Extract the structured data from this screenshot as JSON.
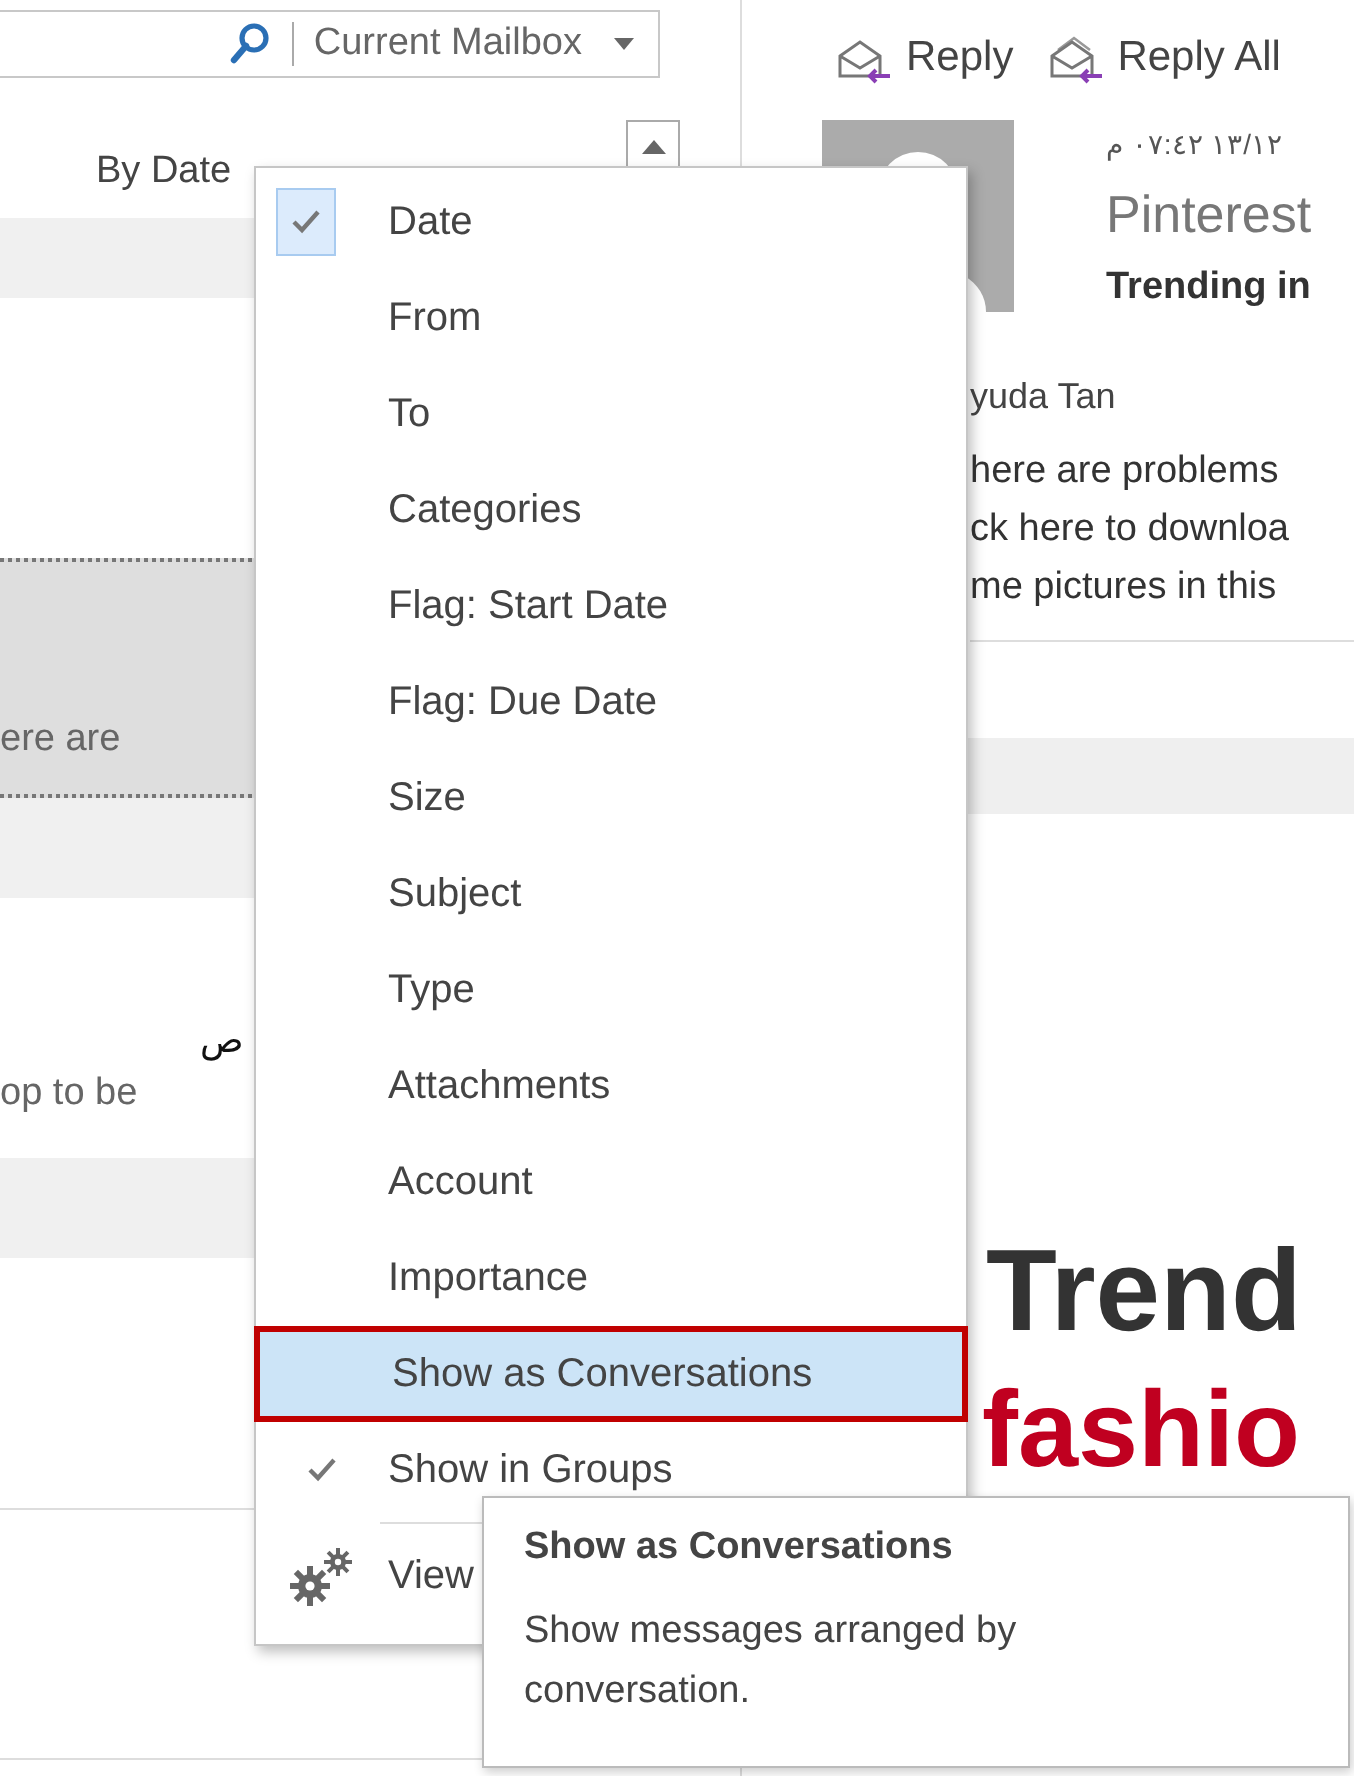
{
  "search": {
    "scope": "Current Mailbox"
  },
  "message_list": {
    "sort_label": "By Date",
    "rows": [
      {
        "kind": "selected",
        "snippet": "ere are"
      },
      {
        "kind": "plain",
        "sender": "ص",
        "snippet": "op to be"
      }
    ]
  },
  "reading_pane": {
    "actions": [
      "Reply",
      "Reply All"
    ],
    "date": "١٣/١٢ ٠٧:٤٢ م",
    "sender": "Pinterest",
    "subject": "Trending in",
    "to": "yuda Tan",
    "notice": [
      "here are problems",
      "ck here to downloa",
      "me pictures in this"
    ],
    "headline": "Trend",
    "headline_accent": "fashio"
  },
  "sort_menu": {
    "items": [
      {
        "kind": "sort",
        "label": "Date",
        "checked": true,
        "selected": false
      },
      {
        "kind": "sort",
        "label": "From",
        "checked": false,
        "selected": false
      },
      {
        "kind": "sort",
        "label": "To",
        "checked": false,
        "selected": false
      },
      {
        "kind": "sort",
        "label": "Categories",
        "checked": false,
        "selected": false
      },
      {
        "kind": "sort",
        "label": "Flag: Start Date",
        "checked": false,
        "selected": false
      },
      {
        "kind": "sort",
        "label": "Flag: Due Date",
        "checked": false,
        "selected": false
      },
      {
        "kind": "sort",
        "label": "Size",
        "checked": false,
        "selected": false
      },
      {
        "kind": "sort",
        "label": "Subject",
        "checked": false,
        "selected": false
      },
      {
        "kind": "sort",
        "label": "Type",
        "checked": false,
        "selected": false
      },
      {
        "kind": "sort",
        "label": "Attachments",
        "checked": false,
        "selected": false
      },
      {
        "kind": "sort",
        "label": "Account",
        "checked": false,
        "selected": false
      },
      {
        "kind": "sort",
        "label": "Importance",
        "checked": false,
        "selected": false
      },
      {
        "kind": "toggle",
        "label": "Show as Conversations",
        "checked": false,
        "selected": true
      },
      {
        "kind": "toggle",
        "label": "Show in Groups",
        "checked": true,
        "selected": false
      },
      {
        "kind": "settings",
        "label": "View",
        "selected": false
      }
    ]
  },
  "tooltip": {
    "title": "Show as Conversations",
    "body": "Show messages arranged by conversation."
  }
}
